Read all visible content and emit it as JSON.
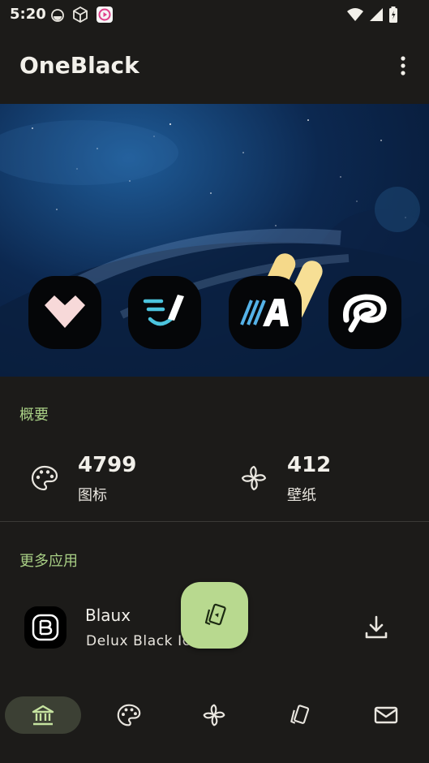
{
  "status": {
    "time": "5:20"
  },
  "app": {
    "title": "OneBlack"
  },
  "hero": {
    "icons": [
      "heart-app-icon",
      "notes-app-icon",
      "font-a-app-icon",
      "clip-studio-app-icon"
    ]
  },
  "overview": {
    "heading": "概要",
    "icons_count": "4799",
    "icons_label": "图标",
    "wallpapers_count": "412",
    "wallpapers_label": "壁纸"
  },
  "more_apps": {
    "heading": "更多应用",
    "items": [
      {
        "name": "Blaux",
        "description": "Delux Black Ico"
      }
    ]
  },
  "colors": {
    "accent": "#a8cf85",
    "fab": "#b8d98f",
    "background": "#1c1b19"
  },
  "nav": [
    "home-icon",
    "palette-icon",
    "pinwheel-icon",
    "cards-icon",
    "mail-icon"
  ]
}
